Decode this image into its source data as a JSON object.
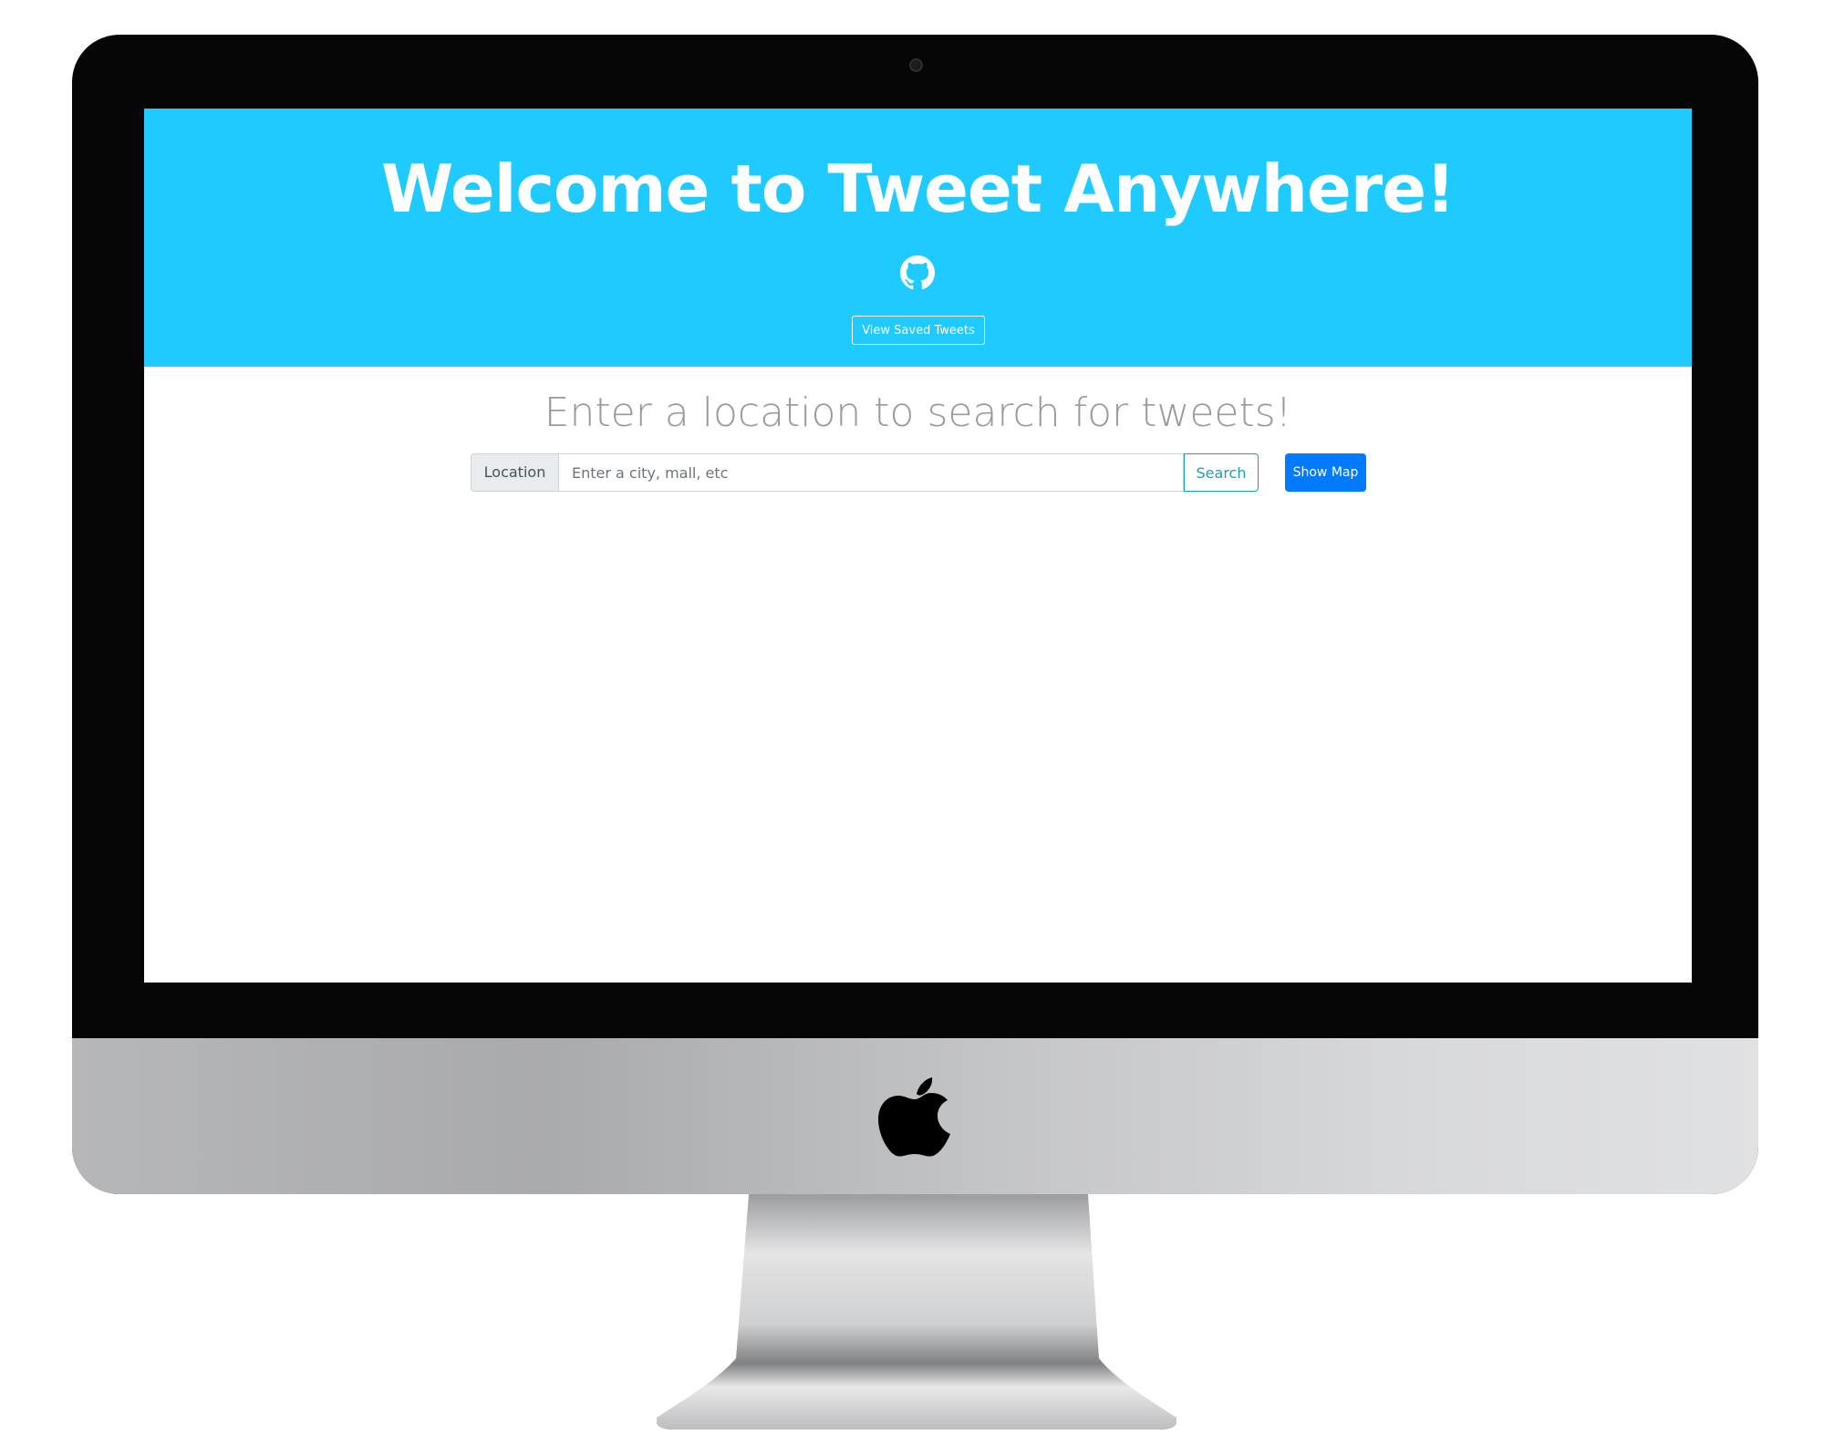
{
  "hero": {
    "title": "Welcome to Tweet Anywhere!",
    "github_icon": "github-icon",
    "saved_button_label": "View Saved Tweets",
    "background_color": "#1fcaff"
  },
  "search": {
    "heading": "Enter a location to search for tweets!",
    "prefix_label": "Location",
    "placeholder": "Enter a city, mall, etc",
    "value": "",
    "search_button_label": "Search",
    "map_button_label": "Show Map",
    "search_color": "#17a2b8",
    "map_color": "#007bff"
  },
  "device": {
    "logo": "apple-logo-icon"
  }
}
